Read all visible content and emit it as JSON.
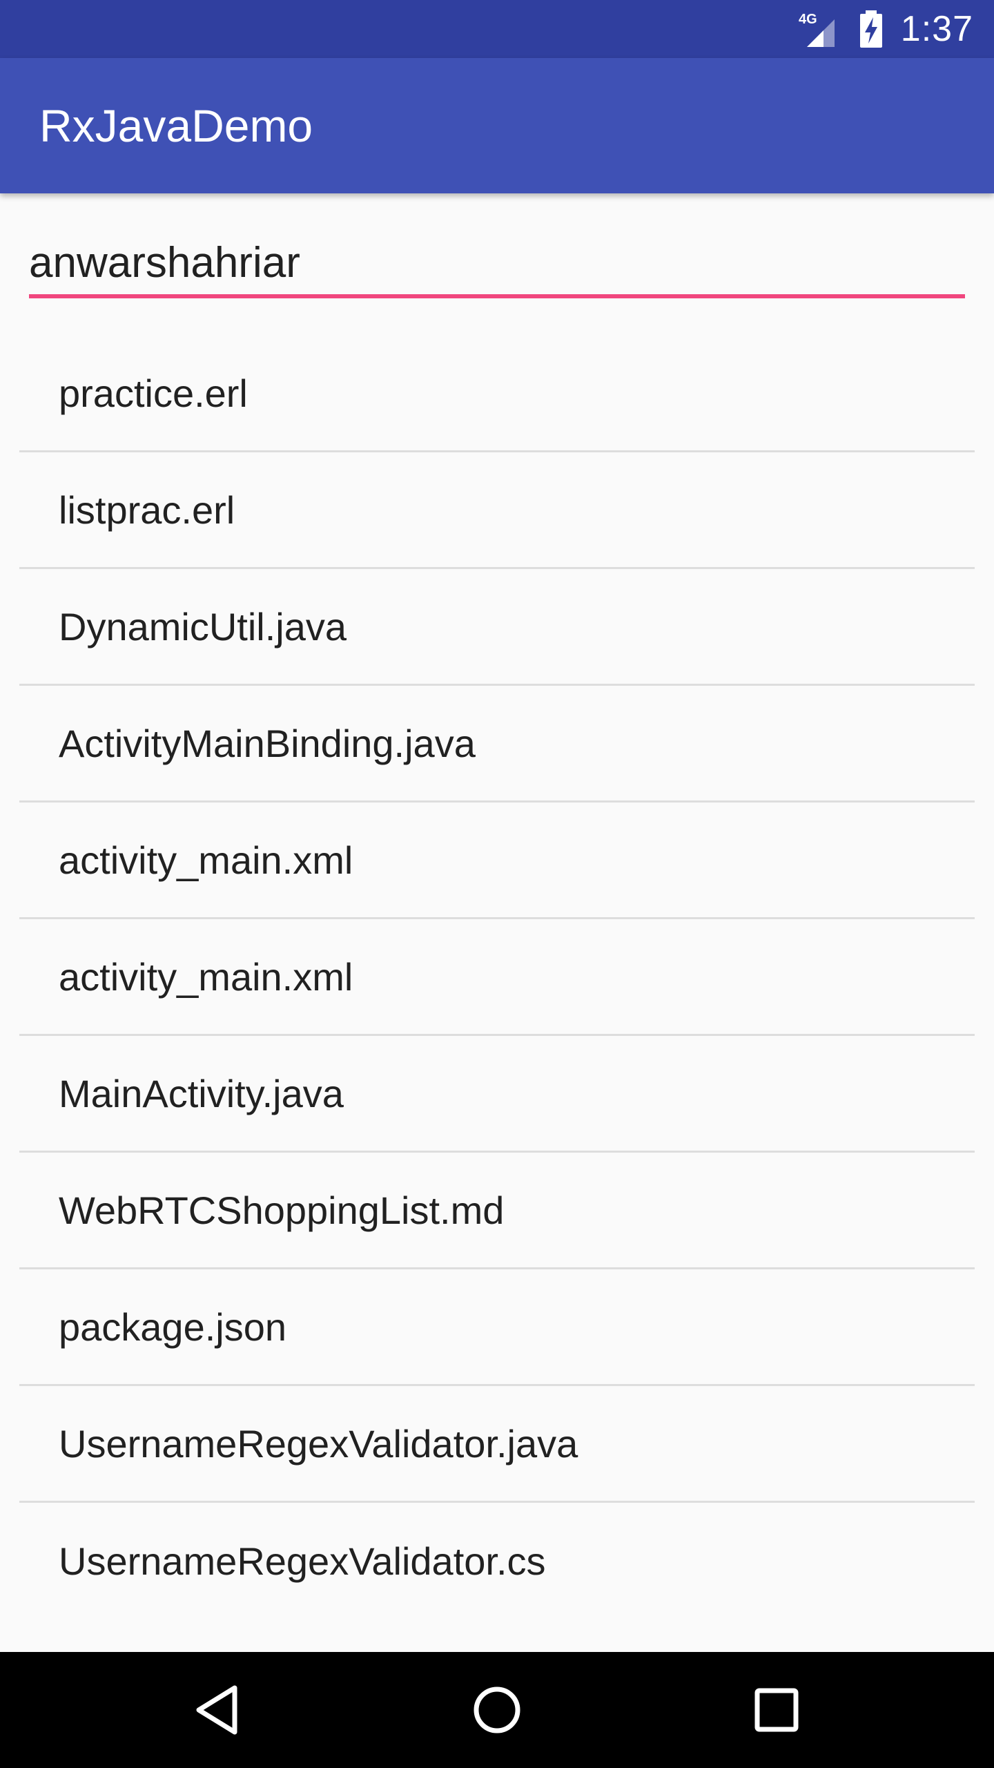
{
  "status_bar": {
    "network_label": "4G",
    "time": "1:37",
    "icons": [
      "signal-icon",
      "battery-charging-icon"
    ]
  },
  "app_bar": {
    "title": "RxJavaDemo"
  },
  "search": {
    "value": "anwarshahriar"
  },
  "colors": {
    "status_bar": "#303f9f",
    "app_bar": "#3f51b5",
    "accent": "#f0467e",
    "background": "#fafafa",
    "nav_bar": "#000000"
  },
  "list": {
    "items": [
      {
        "label": "practice.erl"
      },
      {
        "label": "listprac.erl"
      },
      {
        "label": "DynamicUtil.java"
      },
      {
        "label": "ActivityMainBinding.java"
      },
      {
        "label": "activity_main.xml"
      },
      {
        "label": "activity_main.xml"
      },
      {
        "label": "MainActivity.java"
      },
      {
        "label": "WebRTCShoppingList.md"
      },
      {
        "label": "package.json"
      },
      {
        "label": "UsernameRegexValidator.java"
      },
      {
        "label": "UsernameRegexValidator.cs"
      }
    ]
  },
  "nav_bar": {
    "icons": [
      "back-icon",
      "home-icon",
      "recents-icon"
    ]
  }
}
